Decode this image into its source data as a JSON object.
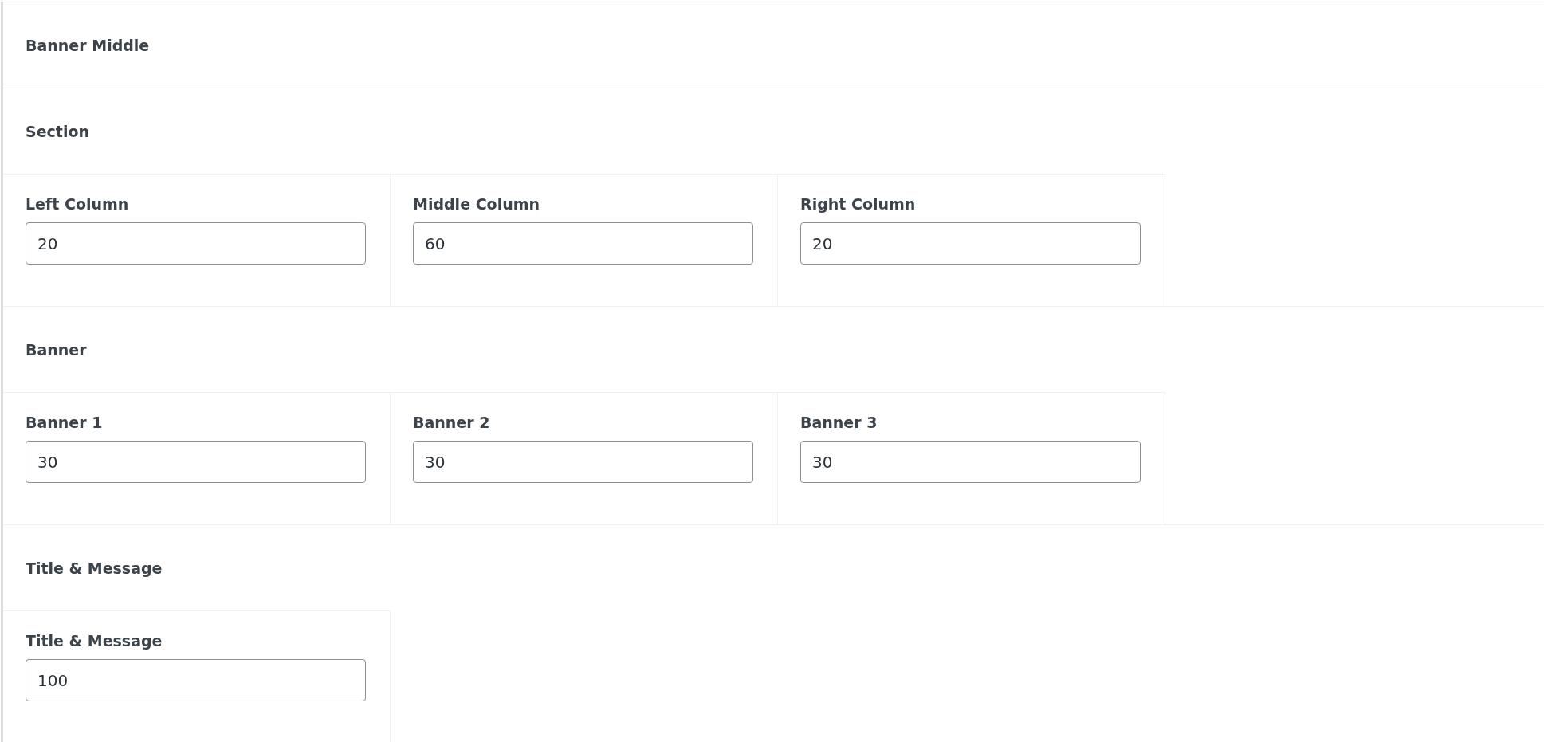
{
  "heading": "Banner Middle",
  "sections": [
    {
      "title": "Section",
      "fields": [
        {
          "label": "Left Column",
          "value": "20"
        },
        {
          "label": "Middle Column",
          "value": "60"
        },
        {
          "label": "Right Column",
          "value": "20"
        }
      ]
    },
    {
      "title": "Banner",
      "fields": [
        {
          "label": "Banner 1",
          "value": "30"
        },
        {
          "label": "Banner 2",
          "value": "30"
        },
        {
          "label": "Banner 3",
          "value": "30"
        }
      ]
    },
    {
      "title": "Title & Message",
      "fields": [
        {
          "label": "Title & Message",
          "value": "100"
        }
      ]
    }
  ]
}
